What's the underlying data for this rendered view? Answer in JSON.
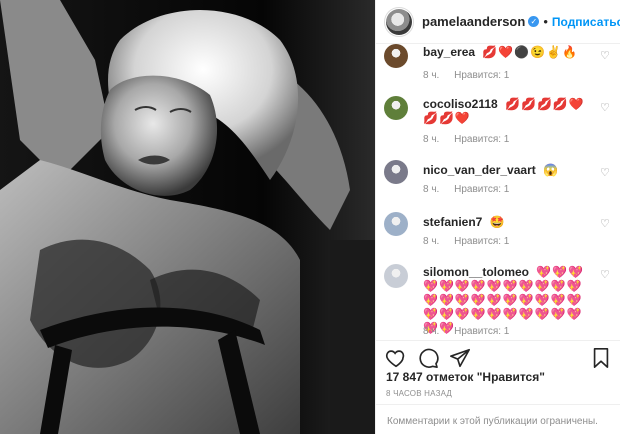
{
  "header": {
    "username": "pamelaanderson",
    "verified_glyph": "✓",
    "separator": "•",
    "follow_label": "Подписаться",
    "more_glyph": "•••"
  },
  "comments": [
    {
      "user": "bay_erea",
      "emojis": "💋❤️⚫😉✌️🔥",
      "age": "8 ч.",
      "likes_label": "Нравится: 1",
      "avatar_color": "#6b4a2c"
    },
    {
      "user": "cocoliso2118",
      "emojis": "💋💋💋💋❤️💋💋❤️",
      "age": "8 ч.",
      "likes_label": "Нравится: 1",
      "avatar_color": "#5f7f3a"
    },
    {
      "user": "nico_van_der_vaart",
      "emojis": "😱",
      "age": "8 ч.",
      "likes_label": "Нравится: 1",
      "avatar_color": "#7a7a8a"
    },
    {
      "user": "stefanien7",
      "emojis": "🤩",
      "age": "8 ч.",
      "likes_label": "Нравится: 1",
      "avatar_color": "#9db0c8"
    },
    {
      "user": "silomon__tolomeo",
      "emojis": "💖💖💖💖💖💖💖💖💖💖💖💖💖💖💖💖💖💖💖💖💖💖💖💖💖💖💖💖💖💖💖💖💖💖💖",
      "age": "8 ч.",
      "likes_label": "Нравится: 1",
      "avatar_color": "#c8cdd6"
    }
  ],
  "actions": {
    "like_icon": "heart-outline-icon",
    "comment_icon": "comment-bubble-icon",
    "share_icon": "paper-plane-icon",
    "save_icon": "bookmark-icon"
  },
  "likes_count": "17 847 отметок \"Нравится\"",
  "posted_time": "8 ЧАСОВ НАЗАД",
  "comments_restricted": "Комментарии к этой публикации ограничены.",
  "colors": {
    "accent": "#0095f6",
    "verified": "#3897f0",
    "muted": "#8e8e8e",
    "text": "#262626"
  }
}
